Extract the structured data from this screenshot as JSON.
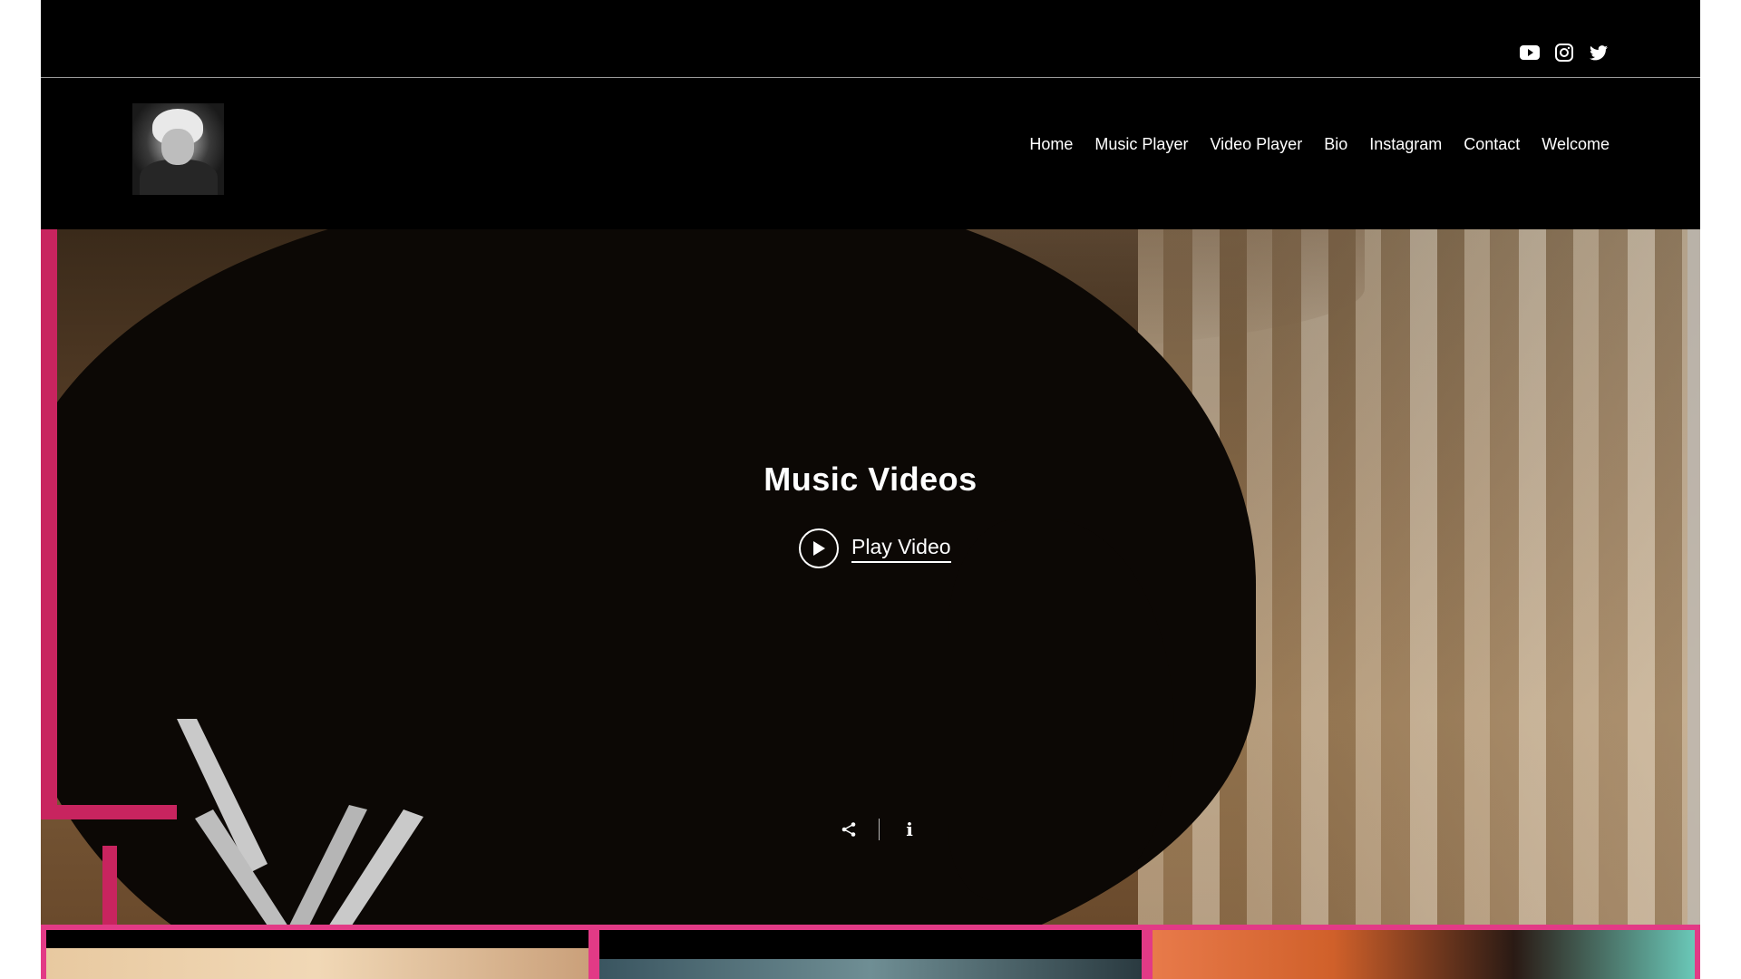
{
  "social": {
    "icons": [
      "youtube-icon",
      "instagram-icon",
      "twitter-icon"
    ]
  },
  "nav": {
    "items": [
      "Home",
      "Music Player",
      "Video Player",
      "Bio",
      "Instagram",
      "Contact",
      "Welcome"
    ]
  },
  "hero": {
    "title": "Music Videos",
    "play_label": "Play Video"
  },
  "colors": {
    "accent_pink": "#e23a86",
    "background": "#000000",
    "text": "#ffffff"
  }
}
